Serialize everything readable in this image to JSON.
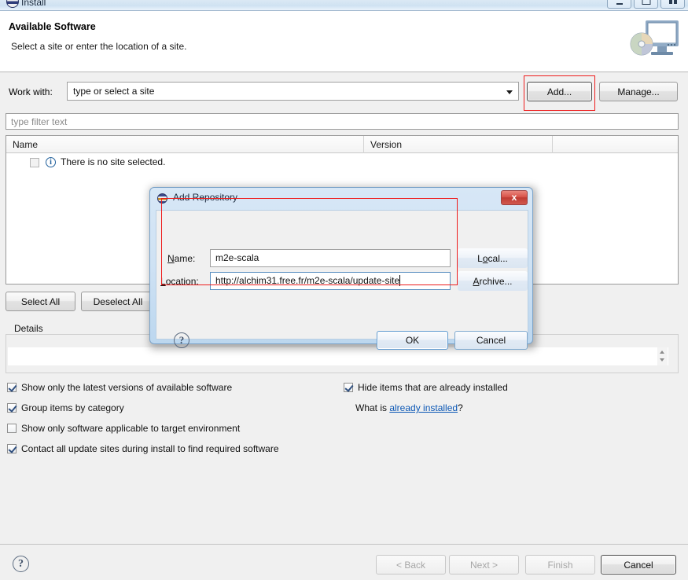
{
  "window": {
    "title": "Install",
    "controls": [
      "minimize",
      "maximize",
      "restore"
    ]
  },
  "header": {
    "title": "Available Software",
    "subtitle": "Select a site or enter the location of a site.",
    "banner_icon": "monitor-cd-icon"
  },
  "work_with": {
    "label": "Work with:",
    "value": "type or select a site",
    "placeholder": "type or select a site",
    "add_label": "Add...",
    "manage_label": "Manage..."
  },
  "filter": {
    "placeholder": "type filter text",
    "value": ""
  },
  "table": {
    "columns": [
      "Name",
      "Version",
      ""
    ],
    "rows": [
      {
        "checked": false,
        "icon": "info-icon",
        "name": "There is no site selected.",
        "version": ""
      }
    ]
  },
  "selection_buttons": {
    "select_all": "Select All",
    "deselect_all": "Deselect All"
  },
  "details": {
    "legend": "Details",
    "value": ""
  },
  "options": {
    "left": [
      {
        "label": "Show only the latest versions of available software",
        "checked": true
      },
      {
        "label": "Group items by category",
        "checked": true
      },
      {
        "label": "Show only software applicable to target environment",
        "checked": false
      },
      {
        "label": "Contact all update sites during install to find required software",
        "checked": true
      }
    ],
    "right": [
      {
        "label": "Hide items that are already installed",
        "checked": true
      }
    ],
    "what_is_prefix": "What is ",
    "what_is_link": "already installed",
    "what_is_suffix": "?"
  },
  "footer": {
    "help_icon": "question-mark-icon",
    "back": "< Back",
    "next": "Next >",
    "finish": "Finish",
    "cancel": "Cancel"
  },
  "dialog": {
    "title": "Add Repository",
    "icon": "eclipse-icon",
    "close_label": "x",
    "name_label": "Name:",
    "name_value": "m2e-scala",
    "location_label": "Location:",
    "location_value": "http://alchim31.free.fr/m2e-scala/update-site",
    "local_label": "Local...",
    "archive_label": "Archive...",
    "help_icon": "question-mark-icon",
    "ok_label": "OK",
    "cancel_label": "Cancel"
  },
  "annotations": {
    "color": "#ee1c1c",
    "boxes": [
      "add-button-highlight",
      "dialog-fields-highlight"
    ]
  }
}
